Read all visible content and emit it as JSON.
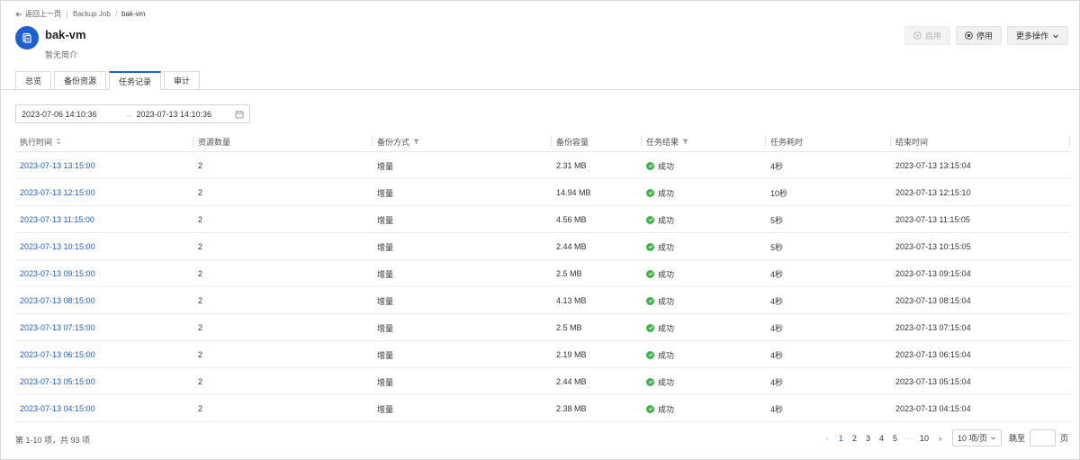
{
  "breadcrumb": {
    "back_label": "返回上一页",
    "parent": "Backup Job",
    "current": "bak-vm"
  },
  "header": {
    "title": "bak-vm",
    "description": "暂无简介"
  },
  "actions": {
    "enable_label": "启用",
    "disable_label": "停用",
    "more_label": "更多操作"
  },
  "tabs": [
    {
      "label": "总览",
      "active": false
    },
    {
      "label": "备份资源",
      "active": false
    },
    {
      "label": "任务记录",
      "active": true
    },
    {
      "label": "审计",
      "active": false
    }
  ],
  "date_range": {
    "start": "2023-07-06 14:10:36",
    "end": "2023-07-13 14:10:36"
  },
  "table": {
    "columns": [
      "执行时间",
      "资源数量",
      "备份方式",
      "备份容量",
      "任务结果",
      "任务耗时",
      "结束时间"
    ],
    "rows": [
      {
        "start": "2023-07-13 13:15:00",
        "count": "2",
        "method": "增量",
        "size": "2.31 MB",
        "result": "成功",
        "duration": "4秒",
        "end": "2023-07-13 13:15:04"
      },
      {
        "start": "2023-07-13 12:15:00",
        "count": "2",
        "method": "增量",
        "size": "14.94 MB",
        "result": "成功",
        "duration": "10秒",
        "end": "2023-07-13 12:15:10"
      },
      {
        "start": "2023-07-13 11:15:00",
        "count": "2",
        "method": "增量",
        "size": "4.56 MB",
        "result": "成功",
        "duration": "5秒",
        "end": "2023-07-13 11:15:05"
      },
      {
        "start": "2023-07-13 10:15:00",
        "count": "2",
        "method": "增量",
        "size": "2.44 MB",
        "result": "成功",
        "duration": "5秒",
        "end": "2023-07-13 10:15:05"
      },
      {
        "start": "2023-07-13 09:15:00",
        "count": "2",
        "method": "增量",
        "size": "2.5 MB",
        "result": "成功",
        "duration": "4秒",
        "end": "2023-07-13 09:15:04"
      },
      {
        "start": "2023-07-13 08:15:00",
        "count": "2",
        "method": "增量",
        "size": "4.13 MB",
        "result": "成功",
        "duration": "4秒",
        "end": "2023-07-13 08:15:04"
      },
      {
        "start": "2023-07-13 07:15:00",
        "count": "2",
        "method": "增量",
        "size": "2.5 MB",
        "result": "成功",
        "duration": "4秒",
        "end": "2023-07-13 07:15:04"
      },
      {
        "start": "2023-07-13 06:15:00",
        "count": "2",
        "method": "增量",
        "size": "2.19 MB",
        "result": "成功",
        "duration": "4秒",
        "end": "2023-07-13 06:15:04"
      },
      {
        "start": "2023-07-13 05:15:00",
        "count": "2",
        "method": "增量",
        "size": "2.44 MB",
        "result": "成功",
        "duration": "4秒",
        "end": "2023-07-13 05:15:04"
      },
      {
        "start": "2023-07-13 04:15:00",
        "count": "2",
        "method": "增量",
        "size": "2.38 MB",
        "result": "成功",
        "duration": "4秒",
        "end": "2023-07-13 04:15:04"
      }
    ]
  },
  "footer": {
    "summary": "第 1-10 项，共 93 项",
    "pages": [
      "1",
      "2",
      "3",
      "4",
      "5"
    ],
    "ellipsis": "···",
    "last_page": "10",
    "current_page": "1",
    "page_size": "10 项/页",
    "jump_label": "跳至",
    "jump_value": "",
    "page_unit": "页"
  },
  "colors": {
    "accent": "#1a61d6",
    "success": "#3bb54a",
    "border": "#d9d9d9"
  },
  "icons": {
    "back": "arrow-left-icon",
    "job": "backup-job-icon",
    "enable": "play-circle-icon",
    "disable": "stop-circle-icon",
    "more": "chevron-down-icon",
    "sort": "sort-icon",
    "filter": "filter-icon",
    "calendar": "calendar-icon",
    "success": "check-circle-icon"
  }
}
